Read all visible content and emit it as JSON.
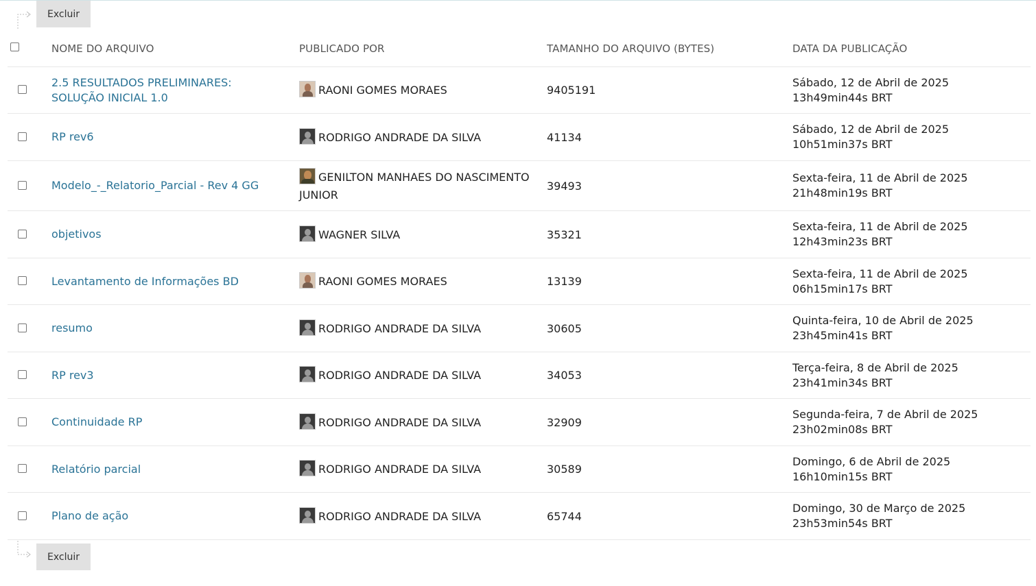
{
  "actions": {
    "delete_label": "Excluir"
  },
  "table": {
    "headers": {
      "name": "NOME DO ARQUIVO",
      "author": "PUBLICADO POR",
      "size": "TAMANHO DO ARQUIVO (BYTES)",
      "date": "DATA DA PUBLICAÇÃO"
    },
    "rows": [
      {
        "name": "2.5 RESULTADOS PRELIMINARES: SOLUÇÃO INICIAL 1.0",
        "author": "RAONI GOMES MORAES",
        "avatar": "photo-a",
        "size": "9405191",
        "date": "Sábado, 12 de Abril de 2025 13h49min44s BRT"
      },
      {
        "name": "RP rev6",
        "author": "RODRIGO ANDRADE DA SILVA",
        "avatar": "default",
        "size": "41134",
        "date": "Sábado, 12 de Abril de 2025 10h51min37s BRT"
      },
      {
        "name": "Modelo_-_Relatorio_Parcial - Rev 4 GG",
        "author": "GENILTON MANHAES DO NASCIMENTO JUNIOR",
        "avatar": "photo-b",
        "size": "39493",
        "date": "Sexta-feira, 11 de Abril de 2025 21h48min19s BRT"
      },
      {
        "name": "objetivos",
        "author": "WAGNER SILVA",
        "avatar": "default",
        "size": "35321",
        "date": "Sexta-feira, 11 de Abril de 2025 12h43min23s BRT"
      },
      {
        "name": "Levantamento de Informações BD",
        "author": "RAONI GOMES MORAES",
        "avatar": "photo-a",
        "size": "13139",
        "date": "Sexta-feira, 11 de Abril de 2025 06h15min17s BRT"
      },
      {
        "name": "resumo",
        "author": "RODRIGO ANDRADE DA SILVA",
        "avatar": "default",
        "size": "30605",
        "date": "Quinta-feira, 10 de Abril de 2025 23h45min41s BRT"
      },
      {
        "name": "RP rev3",
        "author": "RODRIGO ANDRADE DA SILVA",
        "avatar": "default",
        "size": "34053",
        "date": "Terça-feira, 8 de Abril de 2025 23h41min34s BRT"
      },
      {
        "name": "Continuidade RP",
        "author": "RODRIGO ANDRADE DA SILVA",
        "avatar": "default",
        "size": "32909",
        "date": "Segunda-feira, 7 de Abril de 2025 23h02min08s BRT"
      },
      {
        "name": "Relatório parcial",
        "author": "RODRIGO ANDRADE DA SILVA",
        "avatar": "default",
        "size": "30589",
        "date": "Domingo, 6 de Abril de 2025 16h10min15s BRT"
      },
      {
        "name": "Plano de ação",
        "author": "RODRIGO ANDRADE DA SILVA",
        "avatar": "default",
        "size": "65744",
        "date": "Domingo, 30 de Março de 2025 23h53min54s BRT"
      }
    ]
  }
}
